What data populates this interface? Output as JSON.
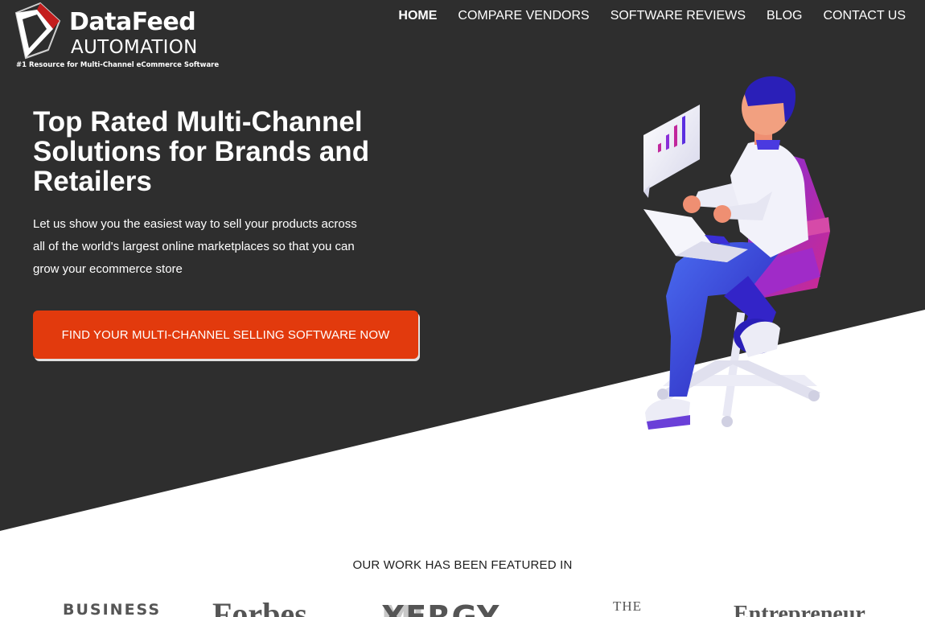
{
  "brand": {
    "name": "DataFeed",
    "sub": "AUTOMATION",
    "tagline": "#1 Resource for Multi-Channel eCommerce Software"
  },
  "nav": {
    "items": [
      {
        "label": "HOME",
        "active": true
      },
      {
        "label": "COMPARE VENDORS",
        "active": false
      },
      {
        "label": "SOFTWARE REVIEWS",
        "active": false
      },
      {
        "label": "BLOG",
        "active": false
      },
      {
        "label": "CONTACT US",
        "active": false
      }
    ]
  },
  "hero": {
    "title_lines": [
      "Top Rated Multi-Channel",
      "Solutions for Brands and",
      "Retailers"
    ],
    "text_lines": [
      "Let us show you the easiest way to sell your products across",
      "all of the world's largest online marketplaces so that you can",
      "grow your ecommerce store"
    ],
    "cta_label": "FIND YOUR MULTI-CHANNEL SELLING SOFTWARE NOW"
  },
  "featured": {
    "title": "OUR WORK HAS BEEN FEATURED IN",
    "logos": {
      "business": "BUSINESS",
      "forbes": "Forbes",
      "mixergy_light": "MI",
      "mixergy_dark": "XERGY",
      "the": "THE",
      "entrepreneur": "Entrepreneur"
    }
  },
  "colors": {
    "hero_bg": "#2e2e2e",
    "cta": "#e23a0d",
    "illustration_blue": "#3a2fd6",
    "illustration_magenta": "#c1279c"
  }
}
